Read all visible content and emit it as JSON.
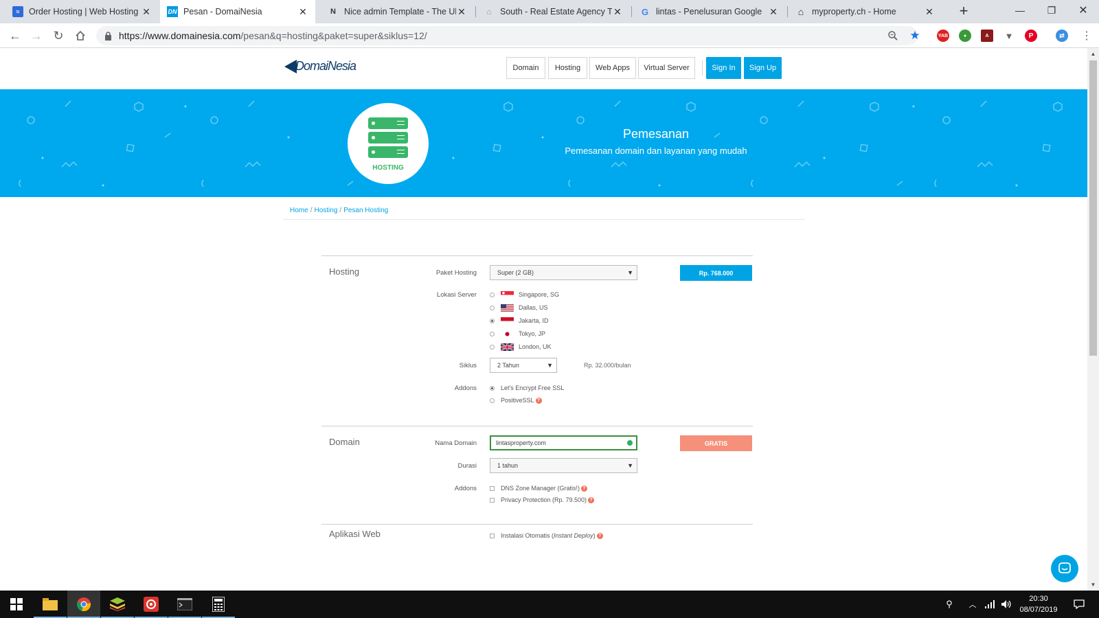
{
  "browser": {
    "tabs": [
      {
        "title": "Order Hosting | Web Hosting In",
        "favicon": "niagahoster-icon",
        "active": false
      },
      {
        "title": "Pesan - DomaiNesia",
        "favicon": "domainesia-icon",
        "active": true
      },
      {
        "title": "Nice admin Template - The Ulti",
        "favicon": "nice-admin-icon",
        "active": false
      },
      {
        "title": "South - Real Estate Agency Tem",
        "favicon": "house-icon",
        "active": false
      },
      {
        "title": "lintas - Penelusuran Google",
        "favicon": "google-icon",
        "active": false
      },
      {
        "title": "myproperty.ch - Home",
        "favicon": "house-outline-icon",
        "active": false
      }
    ],
    "url_host": "https://www.domainesia.com",
    "url_path": "/pesan&q=hosting&paket=super&siklus=12/"
  },
  "site": {
    "logo_text": "DomaiNesia",
    "nav": [
      "Domain",
      "Hosting",
      "Web Apps",
      "Virtual Server"
    ],
    "sign_in": "Sign In",
    "sign_up": "Sign Up",
    "accent_color": "#00a4e4"
  },
  "hero": {
    "icon_label": "HOSTING",
    "title": "Pemesanan",
    "subtitle": "Pemesanan domain dan layanan yang mudah",
    "background": "#00a9ee"
  },
  "breadcrumb": [
    "Home",
    "Hosting",
    "Pesan Hosting"
  ],
  "hosting": {
    "section_title": "Hosting",
    "paket_label": "Paket Hosting",
    "paket_value": "Super (2 GB)",
    "price_button": "Rp. 768.000",
    "lokasi_label": "Lokasi Server",
    "locations": [
      {
        "name": "Singapore, SG",
        "flag": "sg",
        "selected": false
      },
      {
        "name": "Dallas, US",
        "flag": "us",
        "selected": false
      },
      {
        "name": "Jakarta, ID",
        "flag": "id",
        "selected": true
      },
      {
        "name": "Tokyo, JP",
        "flag": "jp",
        "selected": false
      },
      {
        "name": "London, UK",
        "flag": "uk",
        "selected": false
      }
    ],
    "siklus_label": "Siklus",
    "siklus_value": "2 Tahun",
    "monthly_price": "Rp. 32.000/bulan",
    "addons_label": "Addons",
    "addons": [
      {
        "name": "Let's Encrypt Free SSL",
        "selected": true,
        "help": false
      },
      {
        "name": "PositiveSSL",
        "selected": false,
        "help": true
      }
    ]
  },
  "domain": {
    "section_title": "Domain",
    "nama_label": "Nama Domain",
    "nama_value": "lintasproperty.com",
    "free_button": "GRATIS",
    "durasi_label": "Durasi",
    "durasi_value": "1 tahun",
    "addons_label": "Addons",
    "addons": [
      {
        "name": "DNS Zone Manager (Gratis!)",
        "checked": false
      },
      {
        "name": "Privacy Protection (Rp. 79.500)",
        "checked": false
      }
    ]
  },
  "aplikasi": {
    "section_title": "Aplikasi Web",
    "install_label": "Instalasi Otomatis",
    "install_italic": "Instant Deploy"
  },
  "taskbar": {
    "time": "20:30",
    "date": "08/07/2019"
  }
}
